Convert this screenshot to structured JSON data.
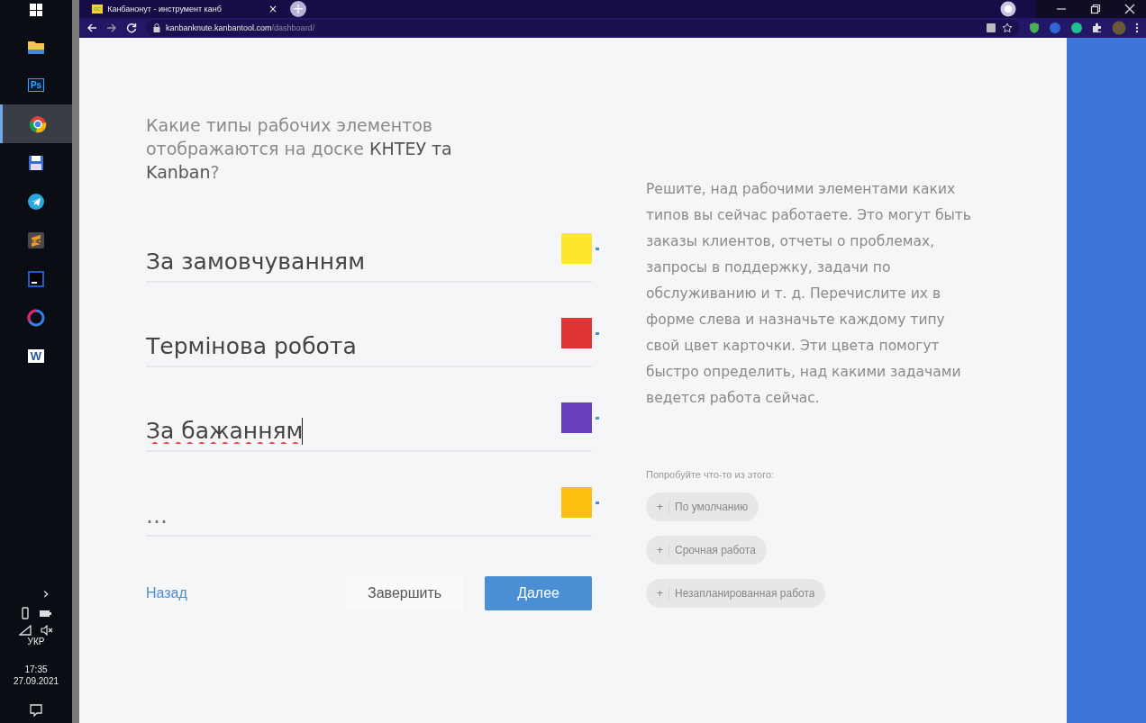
{
  "taskbar": {
    "apps": [
      {
        "kind": "folder",
        "active": false
      },
      {
        "kind": "ps",
        "label": "Ps",
        "active": false
      },
      {
        "kind": "chrome",
        "active": true
      },
      {
        "kind": "save",
        "active": false
      },
      {
        "kind": "telegram",
        "active": false
      },
      {
        "kind": "sublime",
        "active": false
      },
      {
        "kind": "ide",
        "active": false
      },
      {
        "kind": "app",
        "active": false
      },
      {
        "kind": "word",
        "label": "W",
        "active": false
      }
    ],
    "chevron": "›",
    "language": "УКР",
    "time": "17:35",
    "date": "27.09.2021"
  },
  "browser": {
    "tab": {
      "favicon": "oc",
      "title": "Канбанонут - инструмент канб"
    },
    "tab_close": "×",
    "new_tab": "+",
    "address_host": "kanbanknute.kanbantool.com",
    "address_path": "/dashboard/"
  },
  "form": {
    "question": "Какие типы рабочих элементов отображаются на доске **КНТЕУ та Kanban**?",
    "types": [
      {
        "value": "За замовчуванням",
        "color": "#fde62e",
        "focused": false
      },
      {
        "value": "Термінова робота",
        "color": "#e03434",
        "focused": false
      },
      {
        "value": "За бажанням",
        "color": "#6a3fbf",
        "focused": true
      },
      {
        "placeholder": "...",
        "color": "#fbbf0f",
        "focused": false
      }
    ],
    "back": "Назад",
    "finish": "Завершить",
    "next": "Далее"
  },
  "help": {
    "text": "Решите, над рабочими элементами каких типов вы сейчас работаете. Это могут быть заказы клиентов, отчеты о проблемах, запросы в поддержку, задачи по обслуживанию и т. д. Перечислите их в форме слева и назначьте каждому типу свой цвет карточки. Эти цвета помогут быстро определить, над какими задачами ведется работа сейчас.",
    "suggestions_label": "Попробуйте что-то из этого:",
    "suggestions": [
      {
        "plus": "+",
        "label": "По умолчанию"
      },
      {
        "plus": "+",
        "label": "Срочная работа"
      },
      {
        "plus": "+",
        "label": "Незапланированная работа"
      }
    ]
  }
}
